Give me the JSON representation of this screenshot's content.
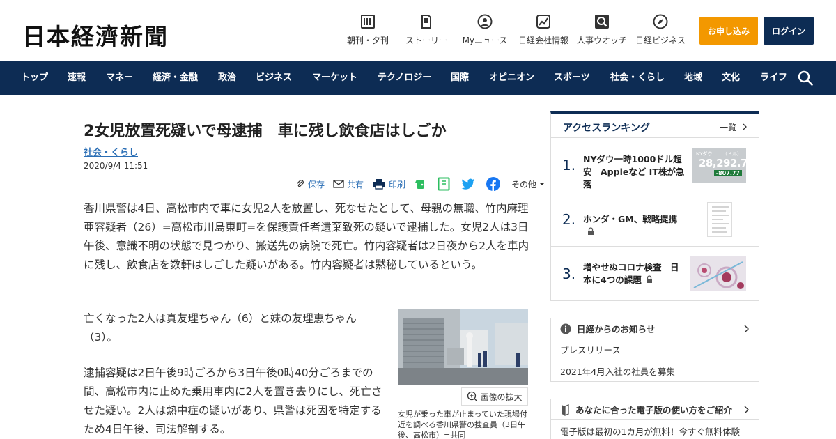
{
  "header": {
    "logo": "日本経濟新聞",
    "utils": [
      {
        "label": "朝刊・夕刊",
        "icon": "newspaper-icon"
      },
      {
        "label": "ストーリー",
        "icon": "document-icon"
      },
      {
        "label": "Myニュース",
        "icon": "user-icon"
      },
      {
        "label": "日経会社情報",
        "icon": "chart-icon"
      },
      {
        "label": "人事ウオッチ",
        "icon": "magnifier-icon"
      },
      {
        "label": "日経ビジネス",
        "icon": "compass-icon"
      }
    ],
    "subscribe": "お申し込み",
    "login": "ログイン"
  },
  "nav": [
    "トップ",
    "速報",
    "マネー",
    "経済・金融",
    "政治",
    "ビジネス",
    "マーケット",
    "テクノロジー",
    "国際",
    "オピニオン",
    "スポーツ",
    "社会・くらし",
    "地域",
    "文化",
    "ライフ"
  ],
  "article": {
    "title": "2女児放置死疑いで母逮捕　車に残し飲食店はしごか",
    "category": "社会・くらし",
    "date": "2020/9/4 11:51",
    "share": {
      "save": "保存",
      "share": "共有",
      "print": "印刷",
      "more": "その他"
    },
    "paragraphs": [
      "香川県警は4日、高松市内で車に女児2人を放置し、死なせたとして、母親の無職、竹内麻理亜容疑者（26）=高松市川島東町=を保護責任者遺棄致死の疑いで逮捕した。女児2人は3日午後、意識不明の状態で見つかり、搬送先の病院で死亡。竹内容疑者は2日夜から2人を車内に残し、飲食店を数軒はしごした疑いがある。竹内容疑者は黙秘しているという。",
      "亡くなった2人は真友理ちゃん（6）と妹の友理恵ちゃん（3）。",
      "逮捕容疑は2日午後9時ごろから3日午後0時40分ごろまでの間、高松市内に止めた乗用車内に2人を置き去りにし、死亡させた疑い。2人は熱中症の疑いがあり、県警は死因を特定するため4日午後、司法解剖する。"
    ],
    "photo": {
      "enlarge": "画像の拡大",
      "caption": "女児が乗った車が止まっていた現場付近を調べる香川県警の捜査員（3日午後、高松市）=共同"
    }
  },
  "sidebar": {
    "ranking": {
      "title": "アクセスランキング",
      "more": "一覧",
      "items": [
        {
          "rank": "1.",
          "text": "NYダウ一時1000ドル超安　Appleなど IT株が急落",
          "locked": false,
          "thumb_label": "NYダウ",
          "thumb_unit": "（ドル）",
          "thumb_value": "28,292.73",
          "thumb_change": "-807.77"
        },
        {
          "rank": "2.",
          "text": "ホンダ・GM、戦略提携",
          "locked": true
        },
        {
          "rank": "3.",
          "text": "増やせぬコロナ検査　日本に4つの課題",
          "locked": true
        }
      ]
    },
    "notice": {
      "title": "日経からのお知らせ",
      "items": [
        "プレスリリース",
        "2021年4月入社の社員を募集"
      ]
    },
    "edition": {
      "title": "あなたに合った電子版の使い方をご紹介",
      "text": "電子版は最初の1カ月が無料！今すぐ無料体験"
    }
  },
  "colors": {
    "navy": "#0d2c54",
    "orange": "#f39800",
    "link": "#2a6eb5"
  }
}
